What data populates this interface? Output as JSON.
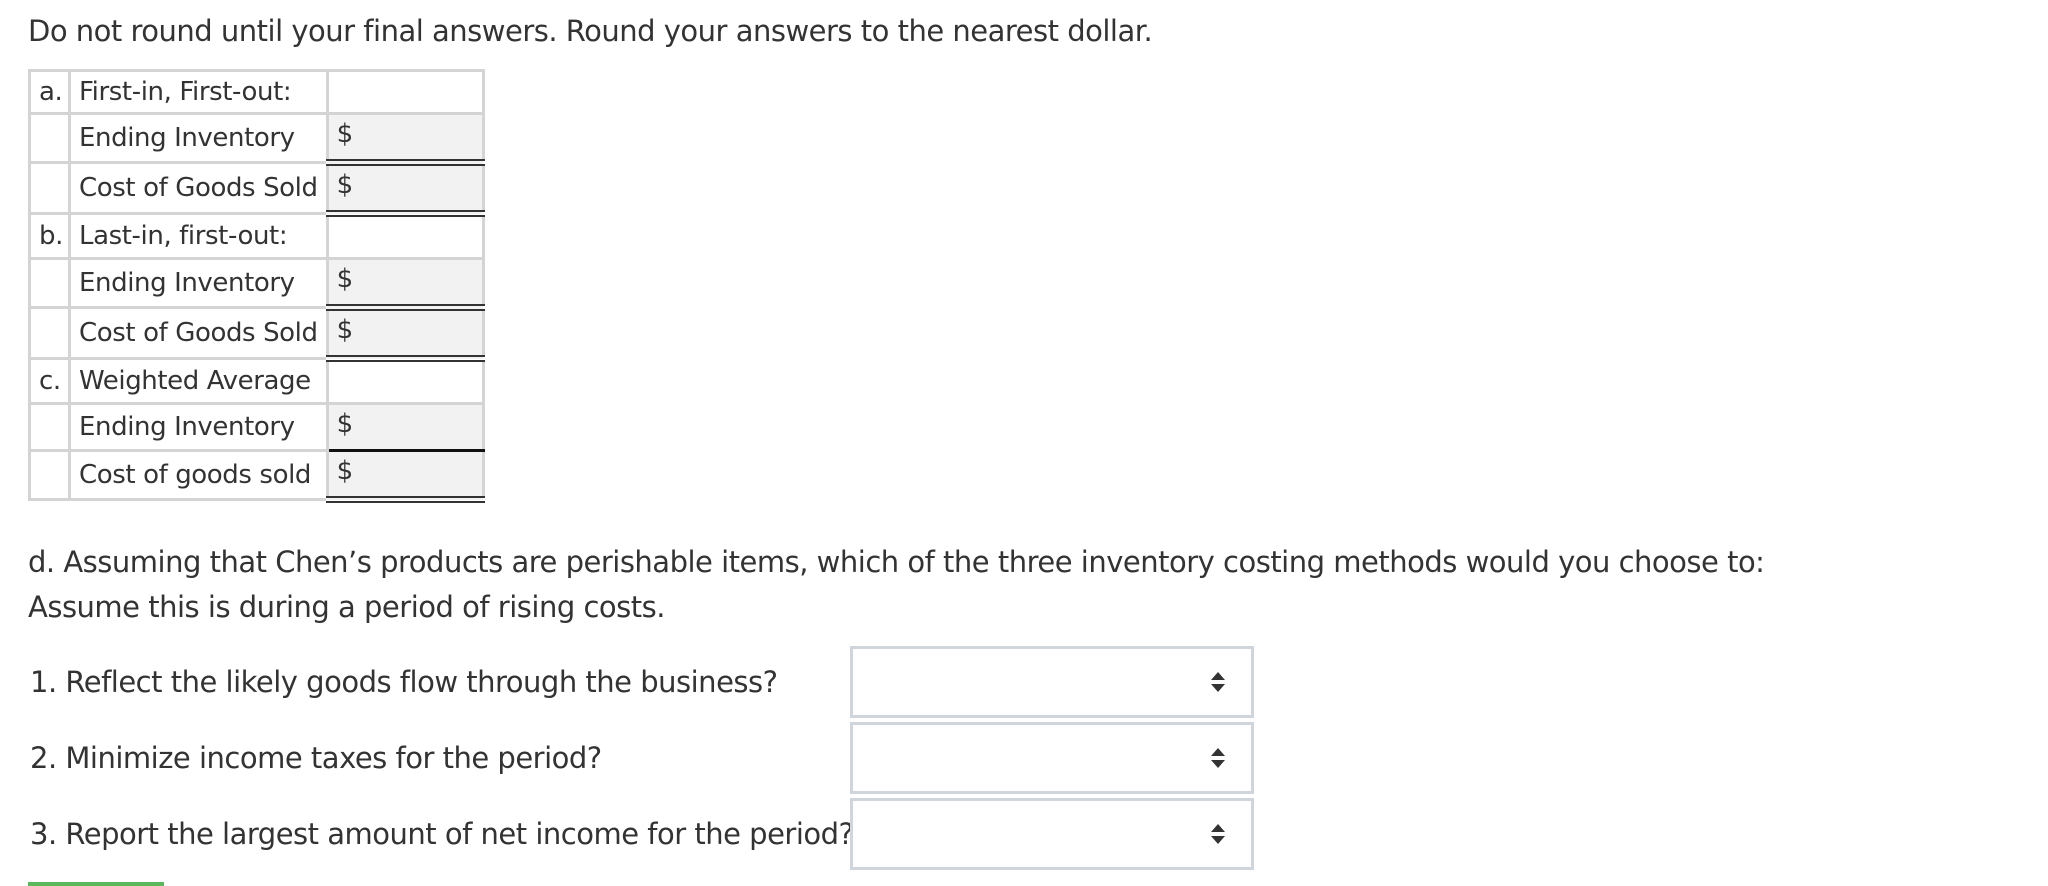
{
  "instruction": "Do not round until your final answers. Round your answers to the nearest dollar.",
  "table": {
    "rows": [
      {
        "letter": "a.",
        "label": "First-in, First-out:",
        "value": "",
        "kind": "header"
      },
      {
        "letter": "",
        "label": "Ending Inventory",
        "value": "$",
        "kind": "input-double"
      },
      {
        "letter": "",
        "label": "Cost of Goods Sold",
        "value": "$",
        "kind": "input-double"
      },
      {
        "letter": "b.",
        "label": "Last-in, first-out:",
        "value": "",
        "kind": "header"
      },
      {
        "letter": "",
        "label": "Ending Inventory",
        "value": "$",
        "kind": "input-double"
      },
      {
        "letter": "",
        "label": "Cost of Goods Sold",
        "value": "$",
        "kind": "input-double"
      },
      {
        "letter": "c.",
        "label": "Weighted Average",
        "value": "",
        "kind": "header"
      },
      {
        "letter": "",
        "label": "Ending Inventory",
        "value": "$",
        "kind": "input-single"
      },
      {
        "letter": "",
        "label": "Cost of goods sold",
        "value": "$",
        "kind": "input-double"
      }
    ]
  },
  "question": {
    "line1": "d. Assuming that Chen’s products are perishable items, which of the three inventory costing methods would you choose to:",
    "line2": "Assume this is during a period of rising costs."
  },
  "subquestions": [
    {
      "label": "1. Reflect the likely goods flow through the business?",
      "selected": ""
    },
    {
      "label": "2. Minimize income taxes for the period?",
      "selected": ""
    },
    {
      "label": "3. Report the largest amount of net income for the period?",
      "selected": ""
    }
  ],
  "colors": {
    "accent_green": "#5cb85c",
    "input_bg": "#f2f2f2",
    "border": "#d4d4d4"
  }
}
